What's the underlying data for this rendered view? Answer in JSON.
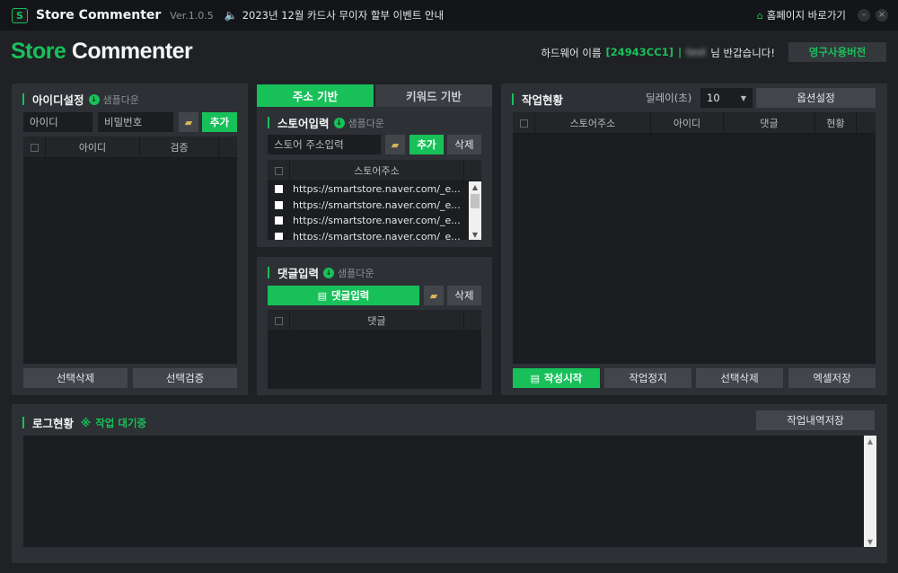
{
  "titlebar": {
    "logo": "S",
    "app_name": "Store Commenter",
    "version": "Ver.1.0.5",
    "notice": "2023년 12월 카드사 무이자 할부 이벤트 안내",
    "home_link": "홈페이지 바로가기",
    "minimize": "–",
    "close": "×"
  },
  "header": {
    "brand_green": "Store",
    "brand_white": "Commenter",
    "hw_prefix": "하드웨어 이름",
    "hw_code": "[24943CC1]",
    "separator": "|",
    "user_name": "test",
    "greeting": "님 반갑습니다!",
    "license_button": "영구사용버전"
  },
  "id_panel": {
    "title": "아이디설정",
    "sample_download": "샘플다운",
    "id_placeholder": "아이디",
    "pw_placeholder": "비밀번호",
    "add": "추가",
    "columns": [
      "아이디",
      "검증"
    ],
    "delete_selected": "선택삭제",
    "verify_selected": "선택검증"
  },
  "tabs": {
    "address": "주소 기반",
    "keyword": "키워드 기반"
  },
  "store_panel": {
    "title": "스토어입력",
    "sample_download": "샘플다운",
    "url_placeholder": "스토어 주소입력",
    "add": "추가",
    "delete": "삭제",
    "column": "스토어주소",
    "rows": [
      "https://smartstore.naver.com/_e...",
      "https://smartstore.naver.com/_e...",
      "https://smartstore.naver.com/_e...",
      "https://smartstore.naver.com/_e..."
    ]
  },
  "comment_panel": {
    "title": "댓글입력",
    "sample_download": "샘플다운",
    "input_button": "댓글입력",
    "delete": "삭제",
    "column": "댓글"
  },
  "job_panel": {
    "title": "작업현황",
    "delay_label": "딜레이(초)",
    "delay_value": "10",
    "options": "옵션설정",
    "columns": [
      "스토어주소",
      "아이디",
      "댓글",
      "현황"
    ],
    "start": "작성시작",
    "stop": "작업정지",
    "delete_selected": "선택삭제",
    "excel_save": "엑셀저장"
  },
  "log_panel": {
    "title": "로그현황",
    "status_icon": "※",
    "status": "작업 대기중",
    "save": "작업내역저장"
  },
  "colors": {
    "accent": "#18c05a",
    "background": "#1f2124",
    "panel": "#2d3034"
  }
}
